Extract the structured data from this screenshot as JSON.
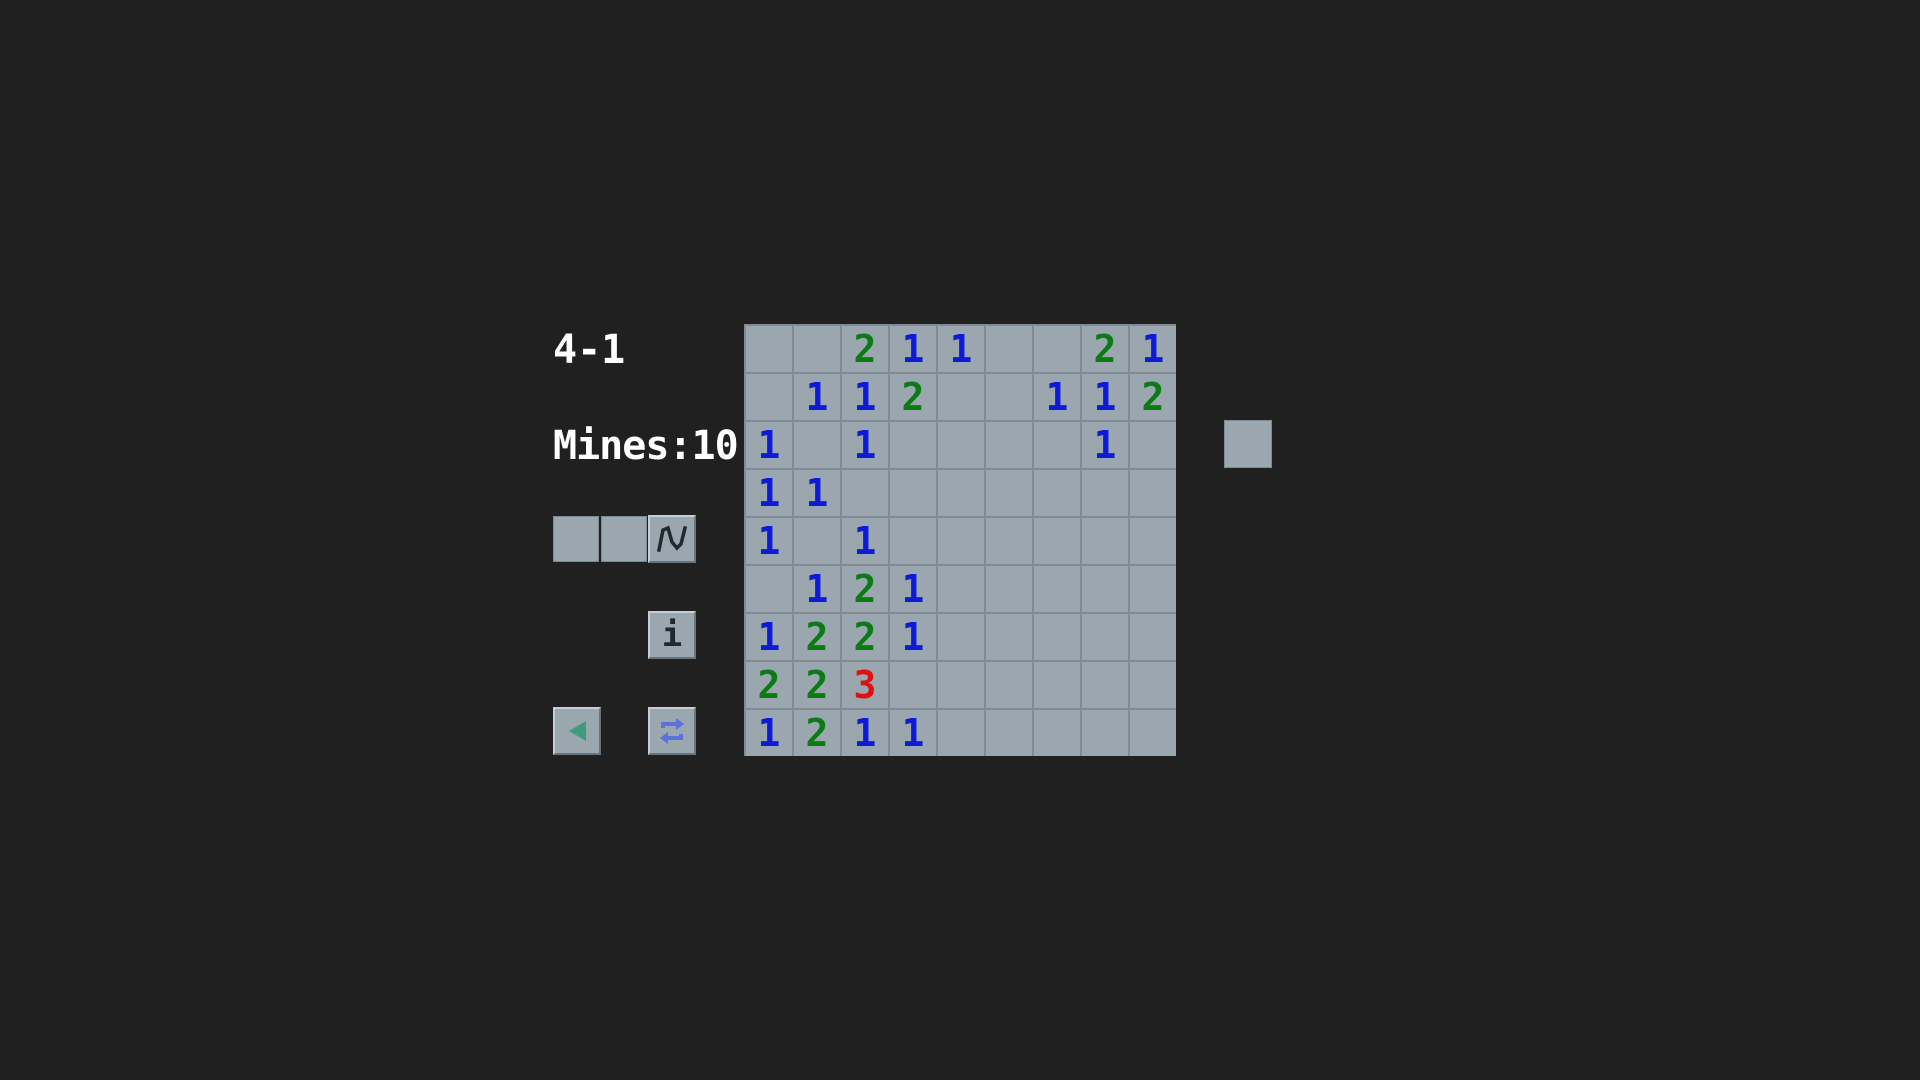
{
  "header": {
    "level": "4-1",
    "mines_label": "Mines:10"
  },
  "toolbar": {
    "slots": [
      "",
      "",
      "snake"
    ],
    "snake_icon": "snake-squiggle-icon",
    "info_label": "i",
    "back_icon": "triangle-left-icon",
    "restart_icon": "refresh-arrows-icon"
  },
  "colors": {
    "background": "#202020",
    "cell": "#9aa7af",
    "grid": "#828b92",
    "number_1": "#0b1bd6",
    "number_2": "#0a7a12",
    "number_3": "#e01010",
    "back_icon": "#3f9b7e",
    "restart_icon": "#5c72d8"
  },
  "board": {
    "rows": [
      [
        "",
        "",
        "2",
        "1",
        "1",
        "",
        "",
        "2",
        "1"
      ],
      [
        "",
        "1",
        "1",
        "2",
        "",
        "",
        "1",
        "1",
        "2"
      ],
      [
        "1",
        "",
        "1",
        "",
        "",
        "",
        "",
        "1",
        ""
      ],
      [
        "1",
        "1",
        "",
        "",
        "",
        "",
        "",
        "",
        ""
      ],
      [
        "1",
        "",
        "1",
        "",
        "",
        "",
        "",
        "",
        ""
      ],
      [
        "",
        "1",
        "2",
        "1",
        "",
        "",
        "",
        "",
        ""
      ],
      [
        "1",
        "2",
        "2",
        "1",
        "",
        "",
        "",
        "",
        ""
      ],
      [
        "2",
        "2",
        "3",
        "",
        "",
        "",
        "",
        "",
        ""
      ],
      [
        "1",
        "2",
        "1",
        "1",
        "",
        "",
        "",
        "",
        ""
      ]
    ]
  }
}
